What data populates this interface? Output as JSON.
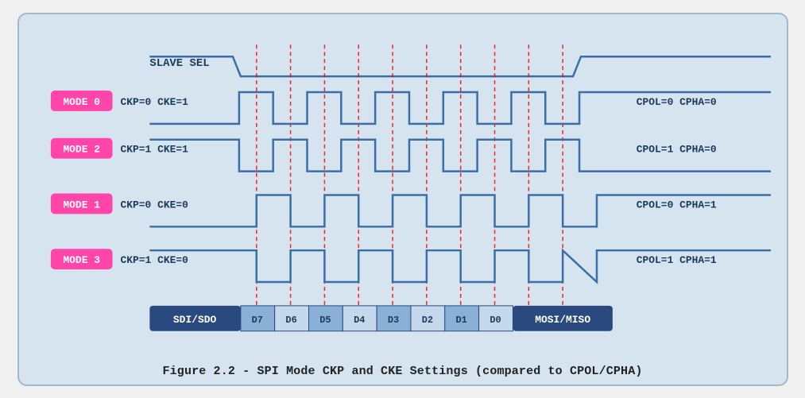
{
  "caption": "Figure 2.2 - SPI Mode CKP and CKE Settings (compared to CPOL/CPHA)",
  "modes": [
    {
      "label": "MODE 0",
      "ckp": "CKP=0",
      "cke": "CKE=1",
      "cpol": "CPOL=0",
      "cpha": "CPHA=0"
    },
    {
      "label": "MODE 2",
      "ckp": "CKP=1",
      "cke": "CKE=1",
      "cpol": "CPOL=1",
      "cpha": "CPHA=0"
    },
    {
      "label": "MODE 1",
      "ckp": "CKP=0",
      "cke": "CKE=0",
      "cpol": "CPOL=0",
      "cpha": "CPHA=1"
    },
    {
      "label": "MODE 3",
      "ckp": "CKP=1",
      "cke": "CKE=0",
      "cpol": "CPOL=1",
      "cpha": "CPHA=1"
    }
  ],
  "slave_sel_label": "SLAVE SEL",
  "data_bits": [
    "D7",
    "D6",
    "D5",
    "D4",
    "D3",
    "D2",
    "D1",
    "D0"
  ],
  "sdi_label": "SDI/SDO",
  "mosi_label": "MOSI/MISO"
}
